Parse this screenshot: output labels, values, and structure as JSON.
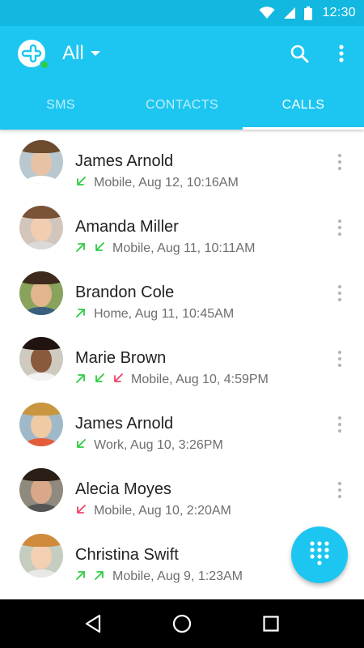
{
  "status_bar": {
    "time": "12:30"
  },
  "app_bar": {
    "filter_label": "All"
  },
  "tabs": [
    {
      "label": "SMS",
      "active": false
    },
    {
      "label": "CONTACTS",
      "active": false
    },
    {
      "label": "CALLS",
      "active": true
    }
  ],
  "colors": {
    "accent": "#1cc6f0",
    "status_bar": "#12b8e0",
    "incoming": "#2ecc40",
    "outgoing": "#2ecc40",
    "missed": "#ee4466",
    "online": "#2ecc40"
  },
  "calls": [
    {
      "name": "James Arnold",
      "detail": "Mobile, Aug 12, 10:16AM",
      "directions": [
        "incoming"
      ]
    },
    {
      "name": "Amanda Miller",
      "detail": "Mobile, Aug 11, 10:11AM",
      "directions": [
        "outgoing",
        "incoming"
      ]
    },
    {
      "name": "Brandon Cole",
      "detail": "Home, Aug 11, 10:45AM",
      "directions": [
        "outgoing"
      ]
    },
    {
      "name": "Marie Brown",
      "detail": "Mobile, Aug 10, 4:59PM",
      "directions": [
        "outgoing",
        "incoming",
        "missed"
      ]
    },
    {
      "name": "James Arnold",
      "detail": "Work, Aug 10, 3:26PM",
      "directions": [
        "incoming"
      ]
    },
    {
      "name": "Alecia Moyes",
      "detail": "Mobile, Aug 10, 2:20AM",
      "directions": [
        "missed"
      ]
    },
    {
      "name": "Christina Swift",
      "detail": "Mobile, Aug 9, 1:23AM",
      "directions": [
        "outgoing",
        "outgoing"
      ]
    }
  ],
  "icons": {
    "status": [
      "wifi-icon",
      "signal-icon",
      "battery-icon"
    ],
    "app_bar": [
      "app-logo-icon",
      "chevron-down-icon",
      "search-icon",
      "overflow-menu-icon"
    ],
    "fab": "dialpad-icon",
    "nav": [
      "back-icon",
      "home-icon",
      "recents-icon"
    ]
  }
}
